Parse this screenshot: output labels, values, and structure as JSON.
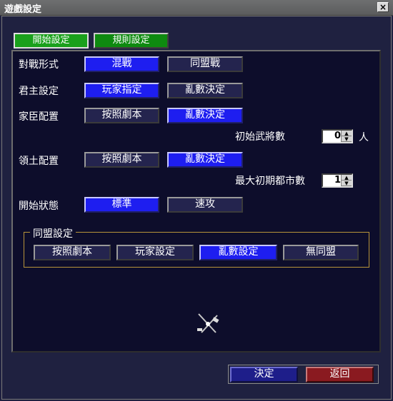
{
  "window": {
    "title": "遊戲設定",
    "close_glyph": "×"
  },
  "tabs": [
    {
      "label": "開始設定",
      "active": true
    },
    {
      "label": "規則設定",
      "active": false
    }
  ],
  "rows": {
    "battle_mode": {
      "label": "對戰形式",
      "options": [
        "混戰",
        "同盟戰"
      ],
      "selected": "混戰"
    },
    "lord": {
      "label": "君主設定",
      "options": [
        "玩家指定",
        "亂數決定"
      ],
      "selected": "玩家指定"
    },
    "vassal": {
      "label": "家臣配置",
      "options": [
        "按照劇本",
        "亂數決定"
      ],
      "selected": "亂數決定"
    },
    "territory": {
      "label": "領土配置",
      "options": [
        "按照劇本",
        "亂數決定"
      ],
      "selected": "亂數決定"
    },
    "start_state": {
      "label": "開始狀態",
      "options": [
        "標準",
        "速攻"
      ],
      "selected": "標準"
    }
  },
  "vassal_count": {
    "label": "初始武將數",
    "value": "0",
    "unit": "人"
  },
  "max_cities": {
    "label": "最大初期都市數",
    "value": "1"
  },
  "alliance": {
    "title": "同盟設定",
    "options": [
      "按照劇本",
      "玩家設定",
      "亂數設定",
      "無同盟"
    ],
    "selected": "亂數設定"
  },
  "footer": {
    "ok_label": "決定",
    "back_label": "返回"
  }
}
